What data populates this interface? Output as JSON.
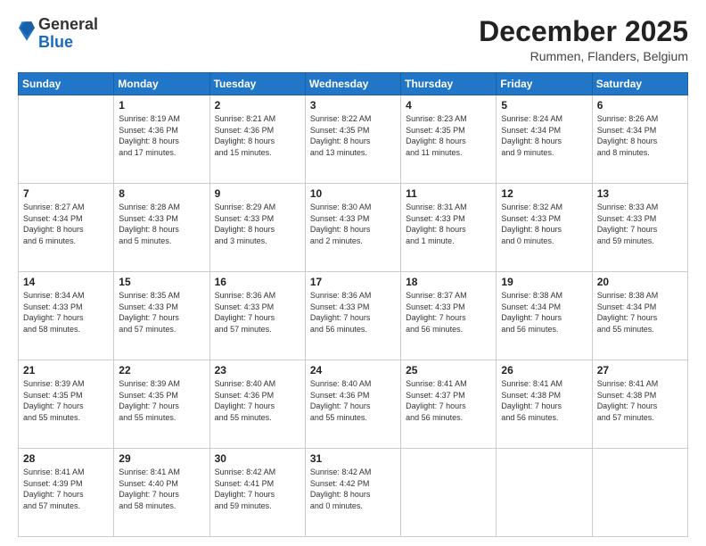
{
  "logo": {
    "general": "General",
    "blue": "Blue"
  },
  "header": {
    "month": "December 2025",
    "location": "Rummen, Flanders, Belgium"
  },
  "weekdays": [
    "Sunday",
    "Monday",
    "Tuesday",
    "Wednesday",
    "Thursday",
    "Friday",
    "Saturday"
  ],
  "weeks": [
    [
      {
        "day": "",
        "info": ""
      },
      {
        "day": "1",
        "info": "Sunrise: 8:19 AM\nSunset: 4:36 PM\nDaylight: 8 hours\nand 17 minutes."
      },
      {
        "day": "2",
        "info": "Sunrise: 8:21 AM\nSunset: 4:36 PM\nDaylight: 8 hours\nand 15 minutes."
      },
      {
        "day": "3",
        "info": "Sunrise: 8:22 AM\nSunset: 4:35 PM\nDaylight: 8 hours\nand 13 minutes."
      },
      {
        "day": "4",
        "info": "Sunrise: 8:23 AM\nSunset: 4:35 PM\nDaylight: 8 hours\nand 11 minutes."
      },
      {
        "day": "5",
        "info": "Sunrise: 8:24 AM\nSunset: 4:34 PM\nDaylight: 8 hours\nand 9 minutes."
      },
      {
        "day": "6",
        "info": "Sunrise: 8:26 AM\nSunset: 4:34 PM\nDaylight: 8 hours\nand 8 minutes."
      }
    ],
    [
      {
        "day": "7",
        "info": "Sunrise: 8:27 AM\nSunset: 4:34 PM\nDaylight: 8 hours\nand 6 minutes."
      },
      {
        "day": "8",
        "info": "Sunrise: 8:28 AM\nSunset: 4:33 PM\nDaylight: 8 hours\nand 5 minutes."
      },
      {
        "day": "9",
        "info": "Sunrise: 8:29 AM\nSunset: 4:33 PM\nDaylight: 8 hours\nand 3 minutes."
      },
      {
        "day": "10",
        "info": "Sunrise: 8:30 AM\nSunset: 4:33 PM\nDaylight: 8 hours\nand 2 minutes."
      },
      {
        "day": "11",
        "info": "Sunrise: 8:31 AM\nSunset: 4:33 PM\nDaylight: 8 hours\nand 1 minute."
      },
      {
        "day": "12",
        "info": "Sunrise: 8:32 AM\nSunset: 4:33 PM\nDaylight: 8 hours\nand 0 minutes."
      },
      {
        "day": "13",
        "info": "Sunrise: 8:33 AM\nSunset: 4:33 PM\nDaylight: 7 hours\nand 59 minutes."
      }
    ],
    [
      {
        "day": "14",
        "info": "Sunrise: 8:34 AM\nSunset: 4:33 PM\nDaylight: 7 hours\nand 58 minutes."
      },
      {
        "day": "15",
        "info": "Sunrise: 8:35 AM\nSunset: 4:33 PM\nDaylight: 7 hours\nand 57 minutes."
      },
      {
        "day": "16",
        "info": "Sunrise: 8:36 AM\nSunset: 4:33 PM\nDaylight: 7 hours\nand 57 minutes."
      },
      {
        "day": "17",
        "info": "Sunrise: 8:36 AM\nSunset: 4:33 PM\nDaylight: 7 hours\nand 56 minutes."
      },
      {
        "day": "18",
        "info": "Sunrise: 8:37 AM\nSunset: 4:33 PM\nDaylight: 7 hours\nand 56 minutes."
      },
      {
        "day": "19",
        "info": "Sunrise: 8:38 AM\nSunset: 4:34 PM\nDaylight: 7 hours\nand 56 minutes."
      },
      {
        "day": "20",
        "info": "Sunrise: 8:38 AM\nSunset: 4:34 PM\nDaylight: 7 hours\nand 55 minutes."
      }
    ],
    [
      {
        "day": "21",
        "info": "Sunrise: 8:39 AM\nSunset: 4:35 PM\nDaylight: 7 hours\nand 55 minutes."
      },
      {
        "day": "22",
        "info": "Sunrise: 8:39 AM\nSunset: 4:35 PM\nDaylight: 7 hours\nand 55 minutes."
      },
      {
        "day": "23",
        "info": "Sunrise: 8:40 AM\nSunset: 4:36 PM\nDaylight: 7 hours\nand 55 minutes."
      },
      {
        "day": "24",
        "info": "Sunrise: 8:40 AM\nSunset: 4:36 PM\nDaylight: 7 hours\nand 55 minutes."
      },
      {
        "day": "25",
        "info": "Sunrise: 8:41 AM\nSunset: 4:37 PM\nDaylight: 7 hours\nand 56 minutes."
      },
      {
        "day": "26",
        "info": "Sunrise: 8:41 AM\nSunset: 4:38 PM\nDaylight: 7 hours\nand 56 minutes."
      },
      {
        "day": "27",
        "info": "Sunrise: 8:41 AM\nSunset: 4:38 PM\nDaylight: 7 hours\nand 57 minutes."
      }
    ],
    [
      {
        "day": "28",
        "info": "Sunrise: 8:41 AM\nSunset: 4:39 PM\nDaylight: 7 hours\nand 57 minutes."
      },
      {
        "day": "29",
        "info": "Sunrise: 8:41 AM\nSunset: 4:40 PM\nDaylight: 7 hours\nand 58 minutes."
      },
      {
        "day": "30",
        "info": "Sunrise: 8:42 AM\nSunset: 4:41 PM\nDaylight: 7 hours\nand 59 minutes."
      },
      {
        "day": "31",
        "info": "Sunrise: 8:42 AM\nSunset: 4:42 PM\nDaylight: 8 hours\nand 0 minutes."
      },
      {
        "day": "",
        "info": ""
      },
      {
        "day": "",
        "info": ""
      },
      {
        "day": "",
        "info": ""
      }
    ]
  ]
}
